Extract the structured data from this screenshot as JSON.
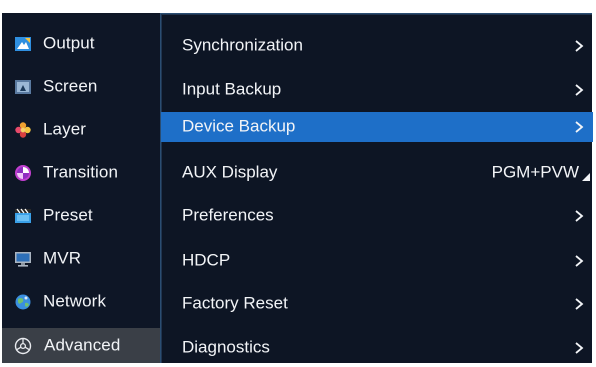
{
  "sidebar": {
    "items": [
      {
        "label": "Output",
        "icon": "output-icon",
        "selected": false
      },
      {
        "label": "Screen",
        "icon": "screen-icon",
        "selected": false
      },
      {
        "label": "Layer",
        "icon": "layer-icon",
        "selected": false
      },
      {
        "label": "Transition",
        "icon": "transition-icon",
        "selected": false
      },
      {
        "label": "Preset",
        "icon": "preset-icon",
        "selected": false
      },
      {
        "label": "MVR",
        "icon": "mvr-icon",
        "selected": false
      },
      {
        "label": "Network",
        "icon": "network-icon",
        "selected": false
      },
      {
        "label": "Advanced",
        "icon": "advanced-icon",
        "selected": true
      }
    ]
  },
  "menu": {
    "items": [
      {
        "label": "Synchronization",
        "indicator": "chevron-right-icon"
      },
      {
        "label": "Input Backup",
        "indicator": "chevron-right-icon"
      },
      {
        "label": "Device Backup",
        "indicator": "chevron-right-icon",
        "selected": true
      },
      {
        "label": "AUX Display",
        "value": "PGM+PVW",
        "indicator": "dropdown-triangle-icon"
      },
      {
        "label": "Preferences",
        "indicator": "chevron-right-icon"
      },
      {
        "label": "HDCP",
        "indicator": "chevron-right-icon"
      },
      {
        "label": "Factory Reset",
        "indicator": "chevron-right-icon"
      },
      {
        "label": "Diagnostics",
        "indicator": "chevron-right-icon"
      }
    ]
  },
  "colors": {
    "background": "#0d1524",
    "selected_menu": "#1e6fc8",
    "selected_sidebar": "#3a3f47",
    "panel_border": "#2a4d72",
    "text": "#f2f4f7"
  }
}
